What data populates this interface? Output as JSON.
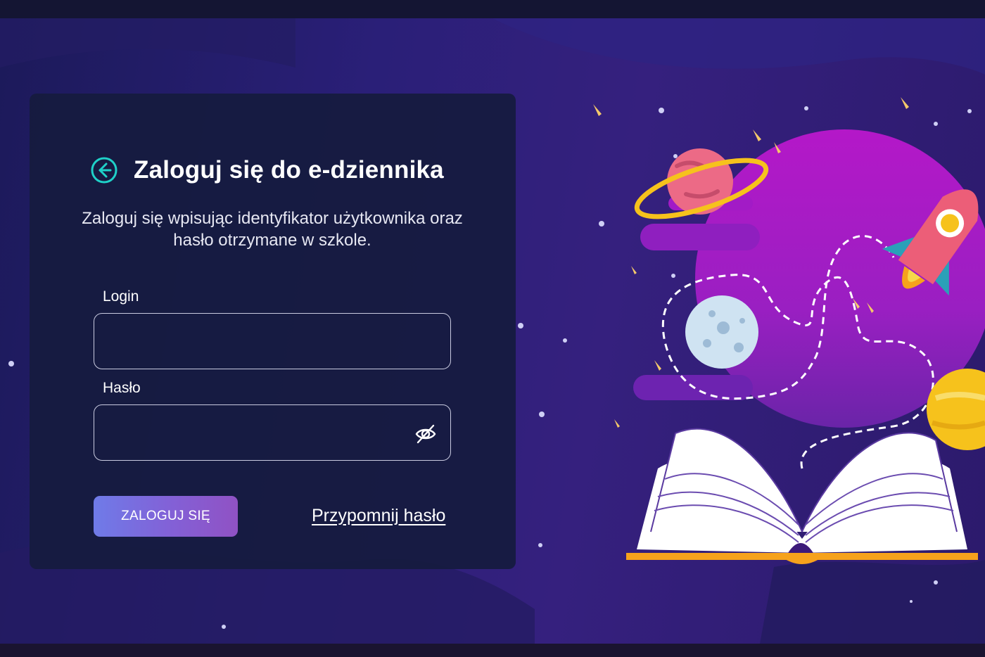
{
  "login_form": {
    "title": "Zaloguj się do e-dziennika",
    "subtitle": "Zaloguj się wpisując identyfikator użytkownika oraz hasło otrzymane w szkole.",
    "login_label": "Login",
    "login_value": "",
    "password_label": "Hasło",
    "password_value": "",
    "submit_label": "ZALOGUJ SIĘ",
    "forgot_label": "Przypomnij hasło"
  },
  "icons": {
    "back": "arrow-left-circle-icon",
    "password_toggle": "eye-off-icon"
  },
  "colors": {
    "accent_teal": "#1fd1c8",
    "button_gradient_start": "#6f7be8",
    "button_gradient_end": "#9052c4",
    "card_background": "#161b3e",
    "background": "#2a1f78"
  }
}
